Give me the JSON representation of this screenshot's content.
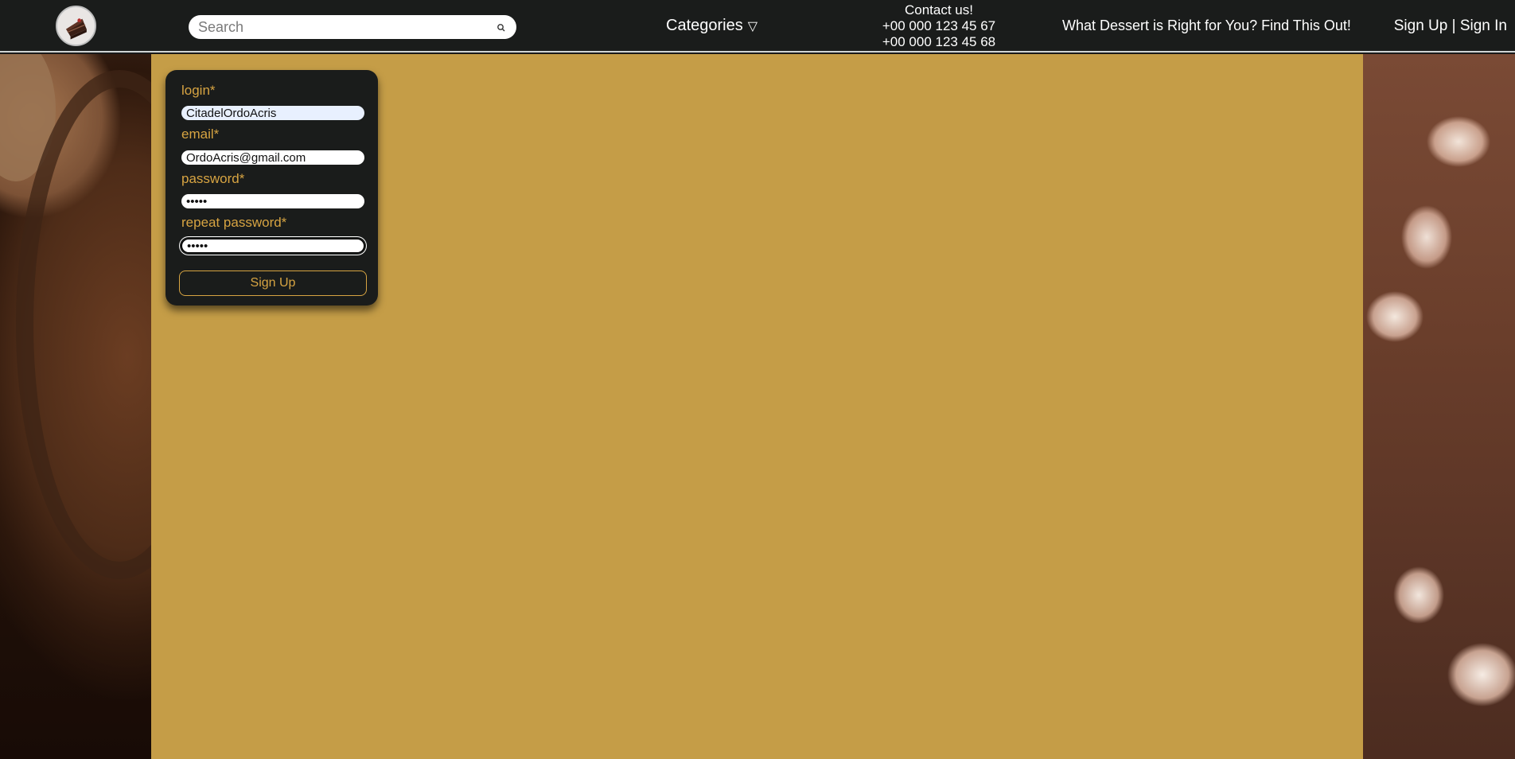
{
  "header": {
    "logo_icon": "cake-slice-logo-icon",
    "search": {
      "placeholder": "Search",
      "value": "",
      "icon": "search-icon"
    },
    "categories": {
      "label": "Categories",
      "arrow": "▽"
    },
    "contact": {
      "title": "Contact us!",
      "phone_1": "+00 000 123 45 67",
      "phone_2": "+00 000 123 45 68"
    },
    "quiz_link": "What Dessert is Right for You? Find This Out!",
    "auth": {
      "signup": "Sign Up",
      "separator": " | ",
      "signin": "Sign In"
    }
  },
  "signup_form": {
    "login": {
      "label": "login*",
      "value": "CitadelOrdoAcris"
    },
    "email": {
      "label": "email*",
      "value": "OrdoAcris@gmail.com"
    },
    "password": {
      "label": "password*",
      "value": "•••••"
    },
    "repeat_password": {
      "label": "repeat password*",
      "value": "•••••"
    },
    "submit_label": "Sign Up"
  },
  "colors": {
    "header_bg": "#1a1c1b",
    "main_bg": "#c59d47",
    "accent_gold": "#d7a442",
    "card_bg": "#1a1c1b"
  }
}
